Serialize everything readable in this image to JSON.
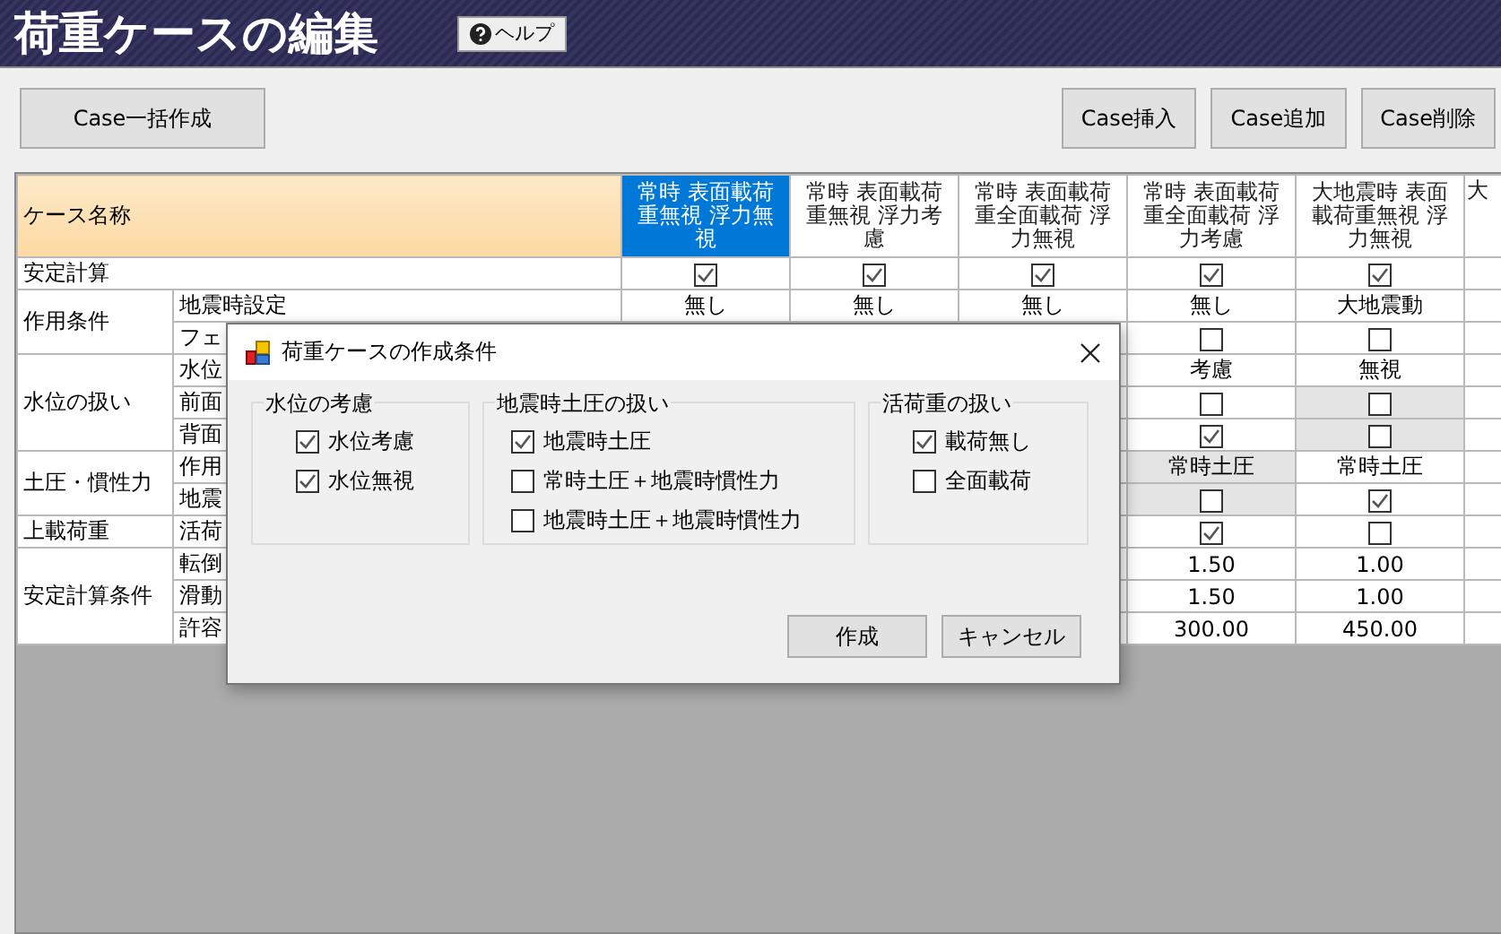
{
  "window": {
    "title": "荷重ケースの編集",
    "help_button": "ヘルプ"
  },
  "toolbar": {
    "left_buttons": [
      "Case一括作成"
    ],
    "right_buttons": [
      "Case挿入",
      "Case追加",
      "Case削除"
    ]
  },
  "grid": {
    "corner": "ケース名称",
    "columns": [
      {
        "header": "常時 表面載荷重無視 浮力無視",
        "selected": true
      },
      {
        "header": "常時 表面載荷重無視 浮力考慮",
        "selected": false
      },
      {
        "header": "常時 表面載荷重全面載荷 浮力無視",
        "selected": false
      },
      {
        "header": "常時 表面載荷重全面載荷 浮力考慮",
        "selected": false
      },
      {
        "header": "大地震時 表面載荷重無視 浮力無視",
        "selected": false
      },
      {
        "header": "大",
        "selected": false
      }
    ],
    "groups": [
      {
        "label": "安定計算",
        "rows": [
          {
            "cells": [
              {
                "kind": "check",
                "checked": true,
                "readonly": false
              },
              {
                "kind": "check",
                "checked": true,
                "readonly": false
              },
              {
                "kind": "check",
                "checked": true,
                "readonly": false
              },
              {
                "kind": "check",
                "checked": true,
                "readonly": false
              },
              {
                "kind": "check",
                "checked": true,
                "readonly": false
              }
            ]
          }
        ]
      },
      {
        "label": "作用条件",
        "rows": [
          {
            "label": "地震時設定",
            "cells": [
              {
                "kind": "text",
                "text": "無し",
                "readonly": false
              },
              {
                "kind": "text",
                "text": "無し",
                "readonly": false
              },
              {
                "kind": "text",
                "text": "無し",
                "readonly": false
              },
              {
                "kind": "text",
                "text": "無し",
                "readonly": false
              },
              {
                "kind": "text",
                "text": "大地震動",
                "readonly": false
              }
            ]
          },
          {
            "label": "フェ",
            "cells": [
              {
                "kind": "check",
                "checked": false,
                "readonly": false
              },
              {
                "kind": "check",
                "checked": false,
                "readonly": false
              }
            ]
          }
        ]
      },
      {
        "label": "水位の扱い",
        "rows": [
          {
            "label": "水位",
            "cells": [
              {
                "kind": "text",
                "text": "考慮",
                "readonly": false
              },
              {
                "kind": "text",
                "text": "無視",
                "readonly": false
              }
            ]
          },
          {
            "label": "前面",
            "cells": [
              {
                "kind": "check",
                "checked": false,
                "readonly": false
              },
              {
                "kind": "check",
                "checked": false,
                "readonly": true
              }
            ]
          },
          {
            "label": "背面",
            "cells": [
              {
                "kind": "check",
                "checked": true,
                "readonly": false
              },
              {
                "kind": "check",
                "checked": false,
                "readonly": true
              }
            ]
          }
        ]
      },
      {
        "label": "土圧・慣性力",
        "rows": [
          {
            "label": "作用",
            "cells": [
              {
                "kind": "text",
                "text": "常時土圧",
                "readonly": true
              },
              {
                "kind": "text",
                "text": "常時土圧",
                "readonly": false
              }
            ]
          },
          {
            "label": "地震",
            "cells": [
              {
                "kind": "check",
                "checked": false,
                "readonly": true
              },
              {
                "kind": "check",
                "checked": true,
                "readonly": false
              }
            ]
          }
        ]
      },
      {
        "label": "上載荷重",
        "rows": [
          {
            "label": "活荷",
            "cells": [
              {
                "kind": "check",
                "checked": true,
                "readonly": false
              },
              {
                "kind": "check",
                "checked": false,
                "readonly": false
              }
            ]
          }
        ]
      },
      {
        "label": "安定計算条件",
        "rows": [
          {
            "label": "転倒",
            "cells": [
              {
                "kind": "text",
                "text": "1.50",
                "readonly": false
              },
              {
                "kind": "text",
                "text": "1.00",
                "readonly": false
              }
            ]
          },
          {
            "label": "滑動",
            "cells": [
              {
                "kind": "text",
                "text": "1.50",
                "readonly": false
              },
              {
                "kind": "text",
                "text": "1.00",
                "readonly": false
              }
            ]
          },
          {
            "label": "許容",
            "cells": [
              {
                "kind": "text",
                "text": "300.00",
                "readonly": false
              },
              {
                "kind": "text",
                "text": "450.00",
                "readonly": false
              }
            ]
          }
        ]
      }
    ]
  },
  "dialog": {
    "title": "荷重ケースの作成条件",
    "groups": [
      {
        "title": "水位の考慮",
        "options": [
          {
            "label": "水位考慮",
            "checked": true
          },
          {
            "label": "水位無視",
            "checked": true
          }
        ]
      },
      {
        "title": "地震時土圧の扱い",
        "options": [
          {
            "label": "地震時土圧",
            "checked": true
          },
          {
            "label": "常時土圧＋地震時慣性力",
            "checked": false
          },
          {
            "label": "地震時土圧＋地震時慣性力",
            "checked": false
          }
        ]
      },
      {
        "title": "活荷重の扱い",
        "options": [
          {
            "label": "載荷無し",
            "checked": true
          },
          {
            "label": "全面載荷",
            "checked": false
          }
        ]
      }
    ],
    "buttons": [
      "作成",
      "キャンセル"
    ]
  }
}
